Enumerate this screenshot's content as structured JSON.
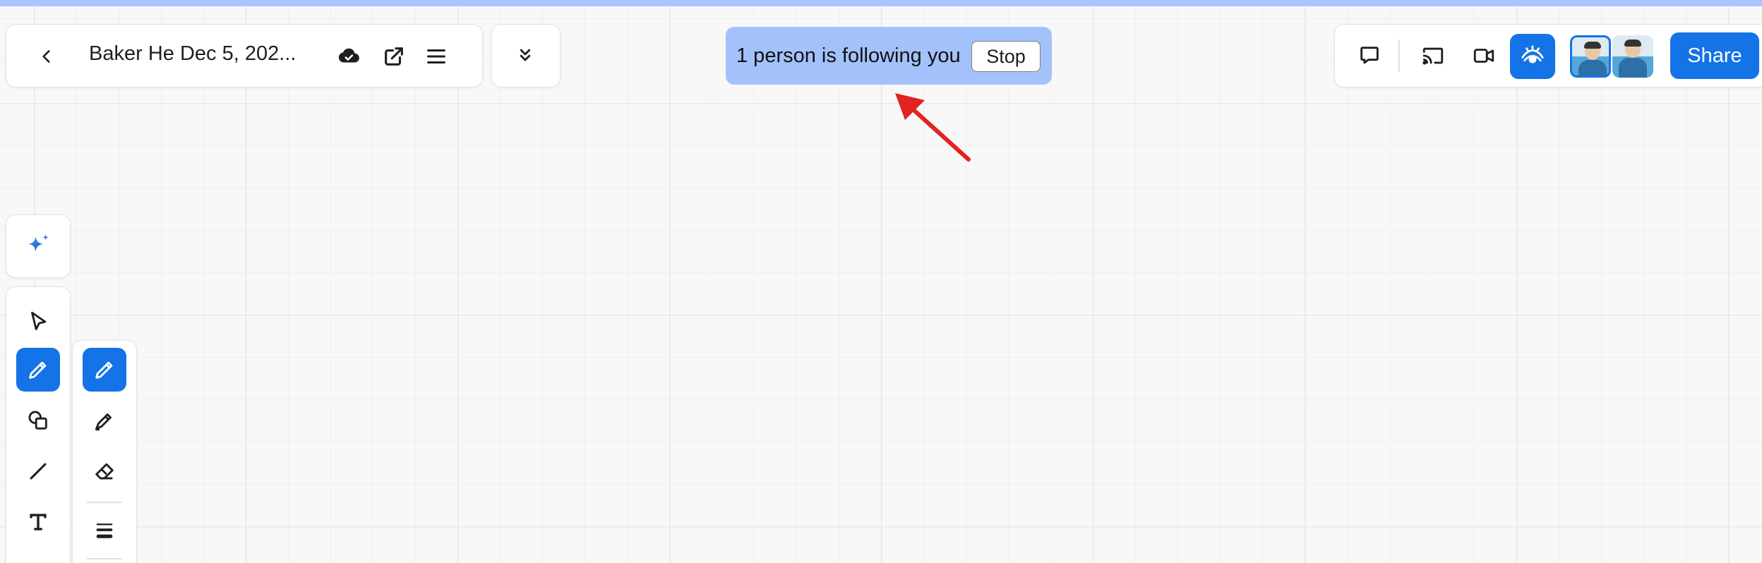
{
  "document": {
    "title": "Baker He Dec 5, 202..."
  },
  "toolbar_left": {
    "back_icon": "chevron-left-icon",
    "cloud_icon": "cloud-saved-icon",
    "export_icon": "external-link-icon",
    "menu_icon": "hamburger-menu-icon",
    "collapse_icon": "double-chevron-down-icon"
  },
  "follow_banner": {
    "text": "1 person is following you",
    "stop_label": "Stop",
    "color": "#a3c2fb"
  },
  "toolbar_right": {
    "icons": [
      "comment-icon",
      "cast-icon",
      "video-icon",
      "eye-follow-icon"
    ],
    "share_label": "Share",
    "accent_color": "#1473e6"
  },
  "avatars": [
    "avatar-user-1",
    "avatar-user-2"
  ],
  "tools": {
    "ai": "sparkle-icon",
    "items": [
      "select-cursor-icon",
      "pen-icon",
      "shapes-icon",
      "line-icon",
      "text-icon"
    ],
    "active": "pen-icon"
  },
  "pen_submenu": {
    "items": [
      "pen-icon",
      "marker-icon",
      "eraser-icon",
      "stroke-weight-icon"
    ],
    "active": "pen-icon"
  },
  "annotation": {
    "type": "red-arrow",
    "color": "#e32222"
  }
}
